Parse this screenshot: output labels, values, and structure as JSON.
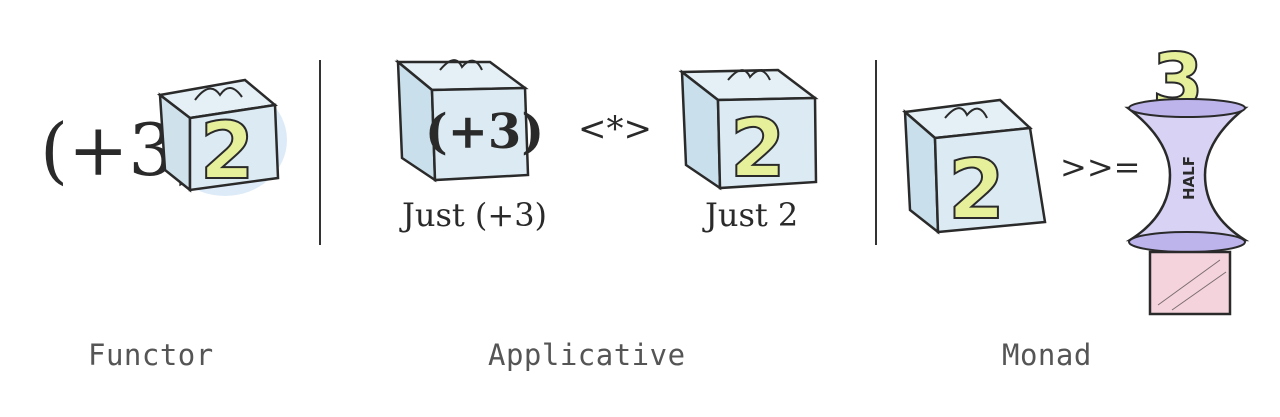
{
  "colors": {
    "ink": "#2a2a2a",
    "box_fill": "#dcebf3",
    "box_glow": "#cfe3f5",
    "number_fill": "#e6ef9a",
    "funnel_fill": "#d8d2f4",
    "pink_box": "#f4d3dc",
    "label_text": "#555555"
  },
  "functor": {
    "func_text": "(+3)",
    "box_value": "2",
    "caption": "Functor"
  },
  "applicative": {
    "left_box_value": "(+3)",
    "left_box_caption": "Just (+3)",
    "operator": "<*>",
    "right_box_value": "2",
    "right_box_caption": "Just 2",
    "caption": "Applicative"
  },
  "monad": {
    "box_value": "2",
    "operator": ">>=",
    "output_value": "3",
    "funnel_label": "HALF",
    "caption": "Monad"
  }
}
